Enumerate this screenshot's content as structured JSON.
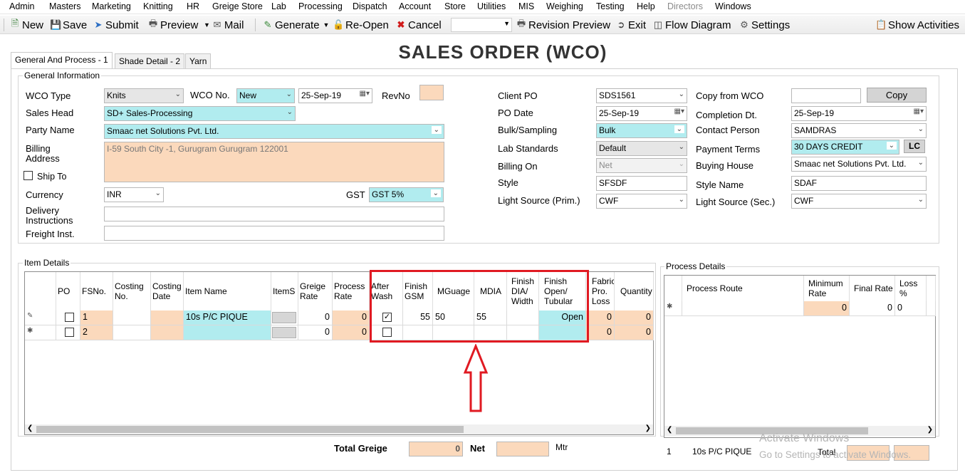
{
  "menu": [
    "Admin",
    "Masters",
    "Marketing",
    "Knitting",
    "HR",
    "Greige Store",
    "Lab",
    "Processing",
    "Dispatch",
    "Account",
    "Store",
    "Utilities",
    "MIS",
    "Weighing",
    "Testing",
    "Help",
    "Directors",
    "Windows"
  ],
  "toolbar": {
    "new": "New",
    "save": "Save",
    "submit": "Submit",
    "preview": "Preview",
    "mail": "Mail",
    "generate": "Generate",
    "reopen": "Re-Open",
    "cancel": "Cancel",
    "revision_preview": "Revision Preview",
    "exit": "Exit",
    "flow_diagram": "Flow Diagram",
    "settings": "Settings",
    "show_activities": "Show Activities"
  },
  "title": "SALES ORDER (WCO)",
  "tabs": [
    "General And Process - 1",
    "Shade Detail - 2",
    "Yarn"
  ],
  "general": {
    "group_title": "General Information",
    "wco_type_label": "WCO Type",
    "wco_type": "Knits",
    "wco_no_label": "WCO No.",
    "wco_no": "New",
    "wco_date": "25-Sep-19",
    "revno_label": "RevNo",
    "sales_head_label": "Sales Head",
    "sales_head": "SD+ Sales-Processing",
    "party_name_label": "Party Name",
    "party_name": "Smaac net Solutions Pvt. Ltd.",
    "billing_address_label_1": "Billing",
    "billing_address_label_2": "Address",
    "billing_address": "I-59 South City -1, Gurugram Gurugram 122001",
    "ship_to_label": "Ship To",
    "currency_label": "Currency",
    "currency": "INR",
    "gst_label": "GST",
    "gst": "GST 5%",
    "delivery_label_1": "Delivery",
    "delivery_label_2": "Instructions",
    "freight_label": "Freight Inst.",
    "client_po_label": "Client PO",
    "client_po": "SDS1561",
    "po_date_label": "PO Date",
    "po_date": "25-Sep-19",
    "bulk_label": "Bulk/Sampling",
    "bulk": "Bulk",
    "lab_std_label": "Lab Standards",
    "lab_std": "Default",
    "billing_on_label": "Billing On",
    "billing_on": "Net",
    "style_label": "Style",
    "style": "SFSDF",
    "light_prim_label": "Light Source (Prim.)",
    "light_prim": "CWF",
    "copy_wco_label": "Copy from WCO",
    "copy_button": "Copy",
    "completion_label": "Completion Dt.",
    "completion": "25-Sep-19",
    "contact_label": "Contact Person",
    "contact": "SAMDRAS",
    "payment_label": "Payment Terms",
    "payment": "30 DAYS CREDIT",
    "lc_button": "LC",
    "buying_label": "Buying House",
    "buying": "Smaac net Solutions Pvt. Ltd.",
    "style_name_label": "Style Name",
    "style_name": "SDAF",
    "light_sec_label": "Light Source (Sec.)",
    "light_sec": "CWF"
  },
  "items": {
    "group_title": "Item Details",
    "headers": [
      "PO",
      "FSNo.",
      "Costing No.",
      "Costing Date",
      "Item Name",
      "ItemS",
      "Greige Rate",
      "Process Rate",
      "After Wash",
      "Finish GSM",
      "MGuage",
      "MDIA",
      "Finish DIA/ Width",
      "Finish Open/ Tubular",
      "Fabric Pro. Loss",
      "Quantity"
    ],
    "rows": [
      {
        "fsno": "1",
        "item_name": "10s P/C PIQUE",
        "greige_rate": "0",
        "process_rate": "0",
        "after_wash": true,
        "gsm": "55",
        "mguage": "50",
        "mdia": "55",
        "open": "Open",
        "loss": "0",
        "qty": "0"
      },
      {
        "fsno": "2",
        "item_name": "",
        "greige_rate": "0",
        "process_rate": "0",
        "after_wash": false,
        "gsm": "",
        "mguage": "",
        "mdia": "",
        "open": "",
        "loss": "0",
        "qty": "0"
      }
    ]
  },
  "process": {
    "group_title": "Process Details",
    "headers": [
      "Process Route",
      "Minimum Rate",
      "Final Rate",
      "Loss %"
    ],
    "row": {
      "min_rate": "0",
      "final_rate": "0",
      "loss": "0"
    }
  },
  "totals": {
    "total_greige_label": "Total Greige",
    "total_greige": "0",
    "net_label": "Net",
    "unit": "Mtr",
    "footer_index": "1",
    "footer_item": "10s P/C PIQUE",
    "total_label": "Total"
  },
  "watermark": {
    "line1": "Activate Windows",
    "line2": "Go to Settings to activate Windows."
  },
  "colors": {
    "highlight_box": "#e01a22",
    "cyan_field": "#b1ecef",
    "peach_field": "#fbd9bc"
  }
}
